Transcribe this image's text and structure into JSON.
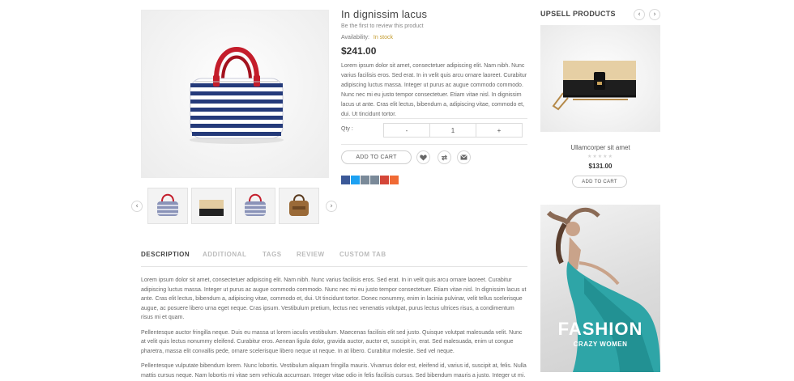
{
  "product": {
    "title": "In dignissim lacus",
    "review_link": "Be the first to review this product",
    "availability_label": "Availability:",
    "availability_value": "In stock",
    "price": "$241.00",
    "short_description": "Lorem ipsum dolor sit amet, consectetuer adipiscing elit. Nam nibh. Nunc varius facilisis eros. Sed erat. In in velit quis arcu ornare laoreet. Curabitur adipiscing luctus massa. Integer ut purus ac augue commodo commodo. Nunc nec mi eu justo tempor consectetuer. Etiam vitae nisl. In dignissim lacus ut ante. Cras elit lectus, bibendum a, adipiscing vitae, commodo et, dui. Ut tincidunt tortor.",
    "qty_label": "Qty :",
    "qty_minus": "-",
    "qty_value": "1",
    "qty_plus": "+",
    "add_to_cart": "ADD TO CART"
  },
  "gallery": {
    "prev_icon": "chevron-left-icon",
    "next_icon": "chevron-right-icon",
    "thumbnails": [
      "striped handbag",
      "beige shoulder bag",
      "striped handbag",
      "brown leather bag"
    ]
  },
  "action_icons": [
    "heart-icon",
    "compare-icon",
    "email-icon"
  ],
  "social_icons": [
    {
      "name": "facebook-icon",
      "color": "#3b5998"
    },
    {
      "name": "twitter-icon",
      "color": "#1da1f2"
    },
    {
      "name": "email-share-icon",
      "color": "#7a8a99"
    },
    {
      "name": "print-icon",
      "color": "#7a8a99"
    },
    {
      "name": "gmail-icon",
      "color": "#d44638"
    },
    {
      "name": "more-share-icon",
      "color": "#f06a35"
    }
  ],
  "tabs": [
    {
      "label": "DESCRIPTION",
      "active": true
    },
    {
      "label": "ADDITIONAL",
      "active": false
    },
    {
      "label": "TAGS",
      "active": false
    },
    {
      "label": "REVIEW",
      "active": false
    },
    {
      "label": "CUSTOM TAB",
      "active": false
    }
  ],
  "description": {
    "p1": "Lorem ipsum dolor sit amet, consectetuer adipiscing elit. Nam nibh. Nunc varius facilisis eros. Sed erat. In in velit quis arcu ornare laoreet. Curabitur adipiscing luctus massa. Integer ut purus ac augue commodo commodo. Nunc nec mi eu justo tempor consectetuer. Etiam vitae nisl. In dignissim lacus ut ante. Cras elit lectus, bibendum a, adipiscing vitae, commodo et, dui. Ut tincidunt tortor. Donec nonummy, enim in lacinia pulvinar, velit tellus scelerisque augue, ac posuere libero urna eget neque. Cras ipsum. Vestibulum pretium, lectus nec venenatis volutpat, purus lectus ultrices risus, a condimentum risus mi et quam.",
    "p2": "Pellentesque auctor fringilla neque. Duis eu massa ut lorem iaculis vestibulum. Maecenas facilisis elit sed justo. Quisque volutpat malesuada velit. Nunc at velit quis lectus nonummy eleifend. Curabitur eros. Aenean ligula dolor, gravida auctor, auctor et, suscipit in, erat. Sed malesuada, enim ut congue pharetra, massa elit convallis pede, ornare scelerisque libero neque ut neque. In at libero. Curabitur molestie. Sed vel neque.",
    "p3": "Pellentesque vulputate bibendum lorem. Nunc lobortis. Vestibulum aliquam fringilla mauris. Vivamus dolor est, eleifend id, varius id, suscipit at, felis. Nulla mattis cursus neque. Nam lobortis mi vitae sem vehicula accumsan. Integer vitae odio in felis facilisis cursus. Sed bibendum mauris a justo. Integer ut mi. Maecenas quis mauris. Integer non lectus at magna elementum posuere."
  },
  "upsell": {
    "title": "UPSELL PRODUCTS",
    "prev_icon": "chevron-left-icon",
    "next_icon": "chevron-right-icon",
    "product_name": "Ullamcorper sit amet",
    "stars": "★★★★★",
    "rating": 0,
    "price": "$131.00",
    "add_to_cart": "ADD TO CART"
  },
  "banner": {
    "headline": "FASHION",
    "subline": "CRAZY WOMEN"
  }
}
